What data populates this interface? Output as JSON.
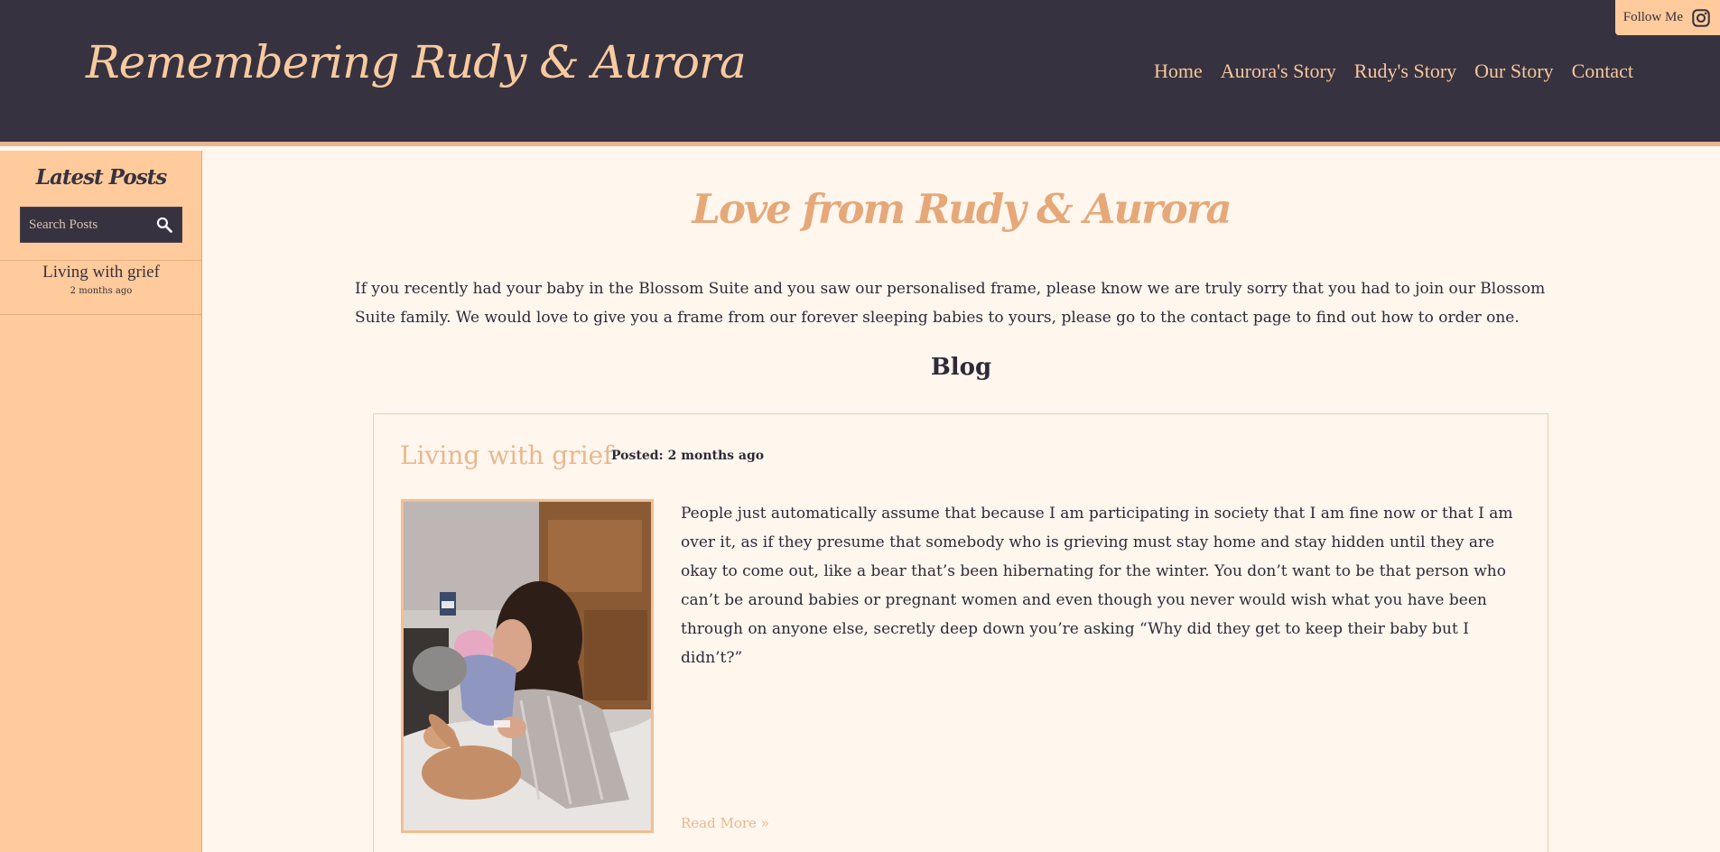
{
  "header": {
    "site_title": "Remembering Rudy & Aurora",
    "nav": [
      "Home",
      "Aurora's Story",
      "Rudy's Story",
      "Our Story",
      "Contact"
    ],
    "follow_label": "Follow Me",
    "follow_icon": "instagram-icon"
  },
  "sidebar": {
    "title": "Latest Posts",
    "search_placeholder": "Search Posts",
    "search_icon": "search-icon",
    "posts": [
      {
        "title": "Living with grief",
        "date": "2 months ago"
      }
    ]
  },
  "main": {
    "title": "Love from Rudy & Aurora",
    "intro": "If you recently had your baby in the Blossom Suite and you saw our personalised frame, please know we are truly sorry that you had to join our Blossom Suite family. We would love to give you a frame from our forever sleeping babies to yours, please go to the contact page to find out how to order one.",
    "blog_heading": "Blog",
    "post": {
      "title": "Living with grief",
      "posted": "Posted: 2 months ago",
      "excerpt": "People just automatically assume that because I am participating in society that I am fine now or that I am over it, as if they presume that somebody who is grieving must stay home and stay hidden until they are okay to come out, like a bear that’s been hibernating for the winter. You don’t want to be that person who can’t be around babies or pregnant women and even though you never would wish what you have been through on anyone else, secretly deep down you’re asking “Why did they get to keep their baby but I didn’t?”",
      "read_more": "Read More »"
    }
  },
  "colors": {
    "header_bg": "#37323f",
    "accent_peach": "#ffcb9c",
    "title_peach": "#e6a878",
    "page_bg": "#fff6ee"
  }
}
